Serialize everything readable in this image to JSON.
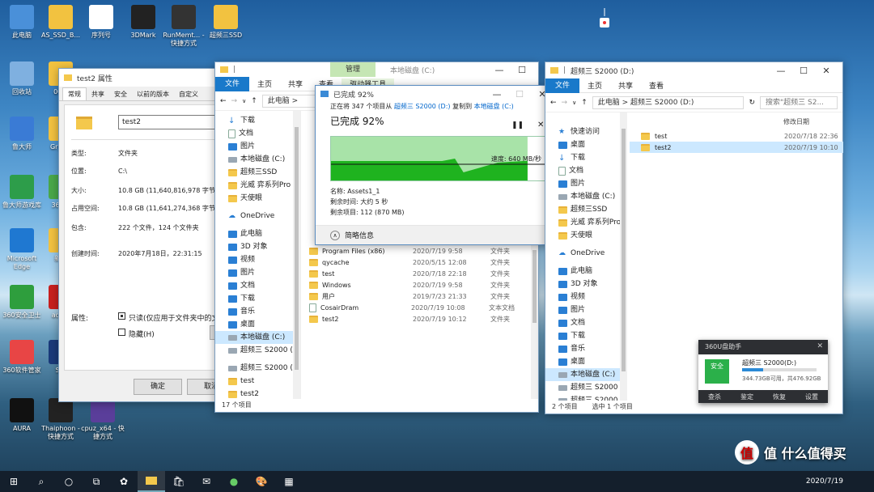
{
  "desktop": {
    "icons": [
      {
        "label": "此电脑",
        "color": "#4a90d9"
      },
      {
        "label": "AS_SSD_B...",
        "color": "#f2c240"
      },
      {
        "label": "序列号",
        "color": "#ffffff"
      },
      {
        "label": "3DMark",
        "color": "#222222"
      },
      {
        "label": "RunMemt... - 快捷方式",
        "color": "#333333"
      },
      {
        "label": "超频三SSD",
        "color": "#f2c240"
      },
      {
        "label": "回收站",
        "color": "#7fb0e0"
      },
      {
        "label": "00...",
        "color": "#f2c240"
      },
      {
        "label": "鲁大师",
        "color": "#3a7bd5"
      },
      {
        "label": "Grys...",
        "color": "#f2c240"
      },
      {
        "label": "鲁大师游戏库",
        "color": "#2d9d4a"
      },
      {
        "label": "360...",
        "color": "#4aa84a"
      },
      {
        "label": "Microsoft Edge",
        "color": "#1f78d1"
      },
      {
        "label": "新...",
        "color": "#f2c240"
      },
      {
        "label": "360安全卫士",
        "color": "#2e9e3d"
      },
      {
        "label": "ada...",
        "color": "#c8201f"
      },
      {
        "label": "360软件管家",
        "color": "#e84545"
      },
      {
        "label": "S...",
        "color": "#1a3a7a"
      },
      {
        "label": "AURA",
        "color": "#111111"
      },
      {
        "label": "Thaiphoon - 快捷方式",
        "color": "#222222"
      },
      {
        "label": "cpuz_x64 - 快捷方式",
        "color": "#5a3e9a"
      }
    ]
  },
  "props": {
    "title": "test2 属性",
    "tabs": [
      "常规",
      "共享",
      "安全",
      "以前的版本",
      "自定义"
    ],
    "name_value": "test2",
    "rows": [
      {
        "label": "类型:",
        "value": "文件夹"
      },
      {
        "label": "位置:",
        "value": "C:\\"
      },
      {
        "label": "大小:",
        "value": "10.8 GB (11,640,816,978 字节)"
      },
      {
        "label": "占用空间:",
        "value": "10.8 GB (11,641,274,368 字节)"
      },
      {
        "label": "包含:",
        "value": "222 个文件，124 个文件夹"
      },
      {
        "label": "创建时间:",
        "value": "2020年7月18日，22:31:15"
      }
    ],
    "attr_label": "属性:",
    "readonly_label": "只读(仅应用于文件夹中的文件)",
    "hidden_label": "隐藏(H)",
    "ok_label": "确定",
    "cancel_label": "取消"
  },
  "explorer_c": {
    "title": "本地磁盘 (C:)",
    "manage_tab": "管理",
    "drive_tools": "驱动器工具",
    "ribbon": [
      "文件",
      "主页",
      "共享",
      "查看"
    ],
    "breadcrumb": "此电脑 >",
    "nav": [
      {
        "label": "下载",
        "icon": "download"
      },
      {
        "label": "文档",
        "icon": "doc"
      },
      {
        "label": "图片",
        "icon": "pic"
      },
      {
        "label": "本地磁盘 (C:)",
        "icon": "drive"
      },
      {
        "label": "超频三SSD",
        "icon": "folder"
      },
      {
        "label": "光威 弈系列Pro",
        "icon": "folder"
      },
      {
        "label": "天使眼",
        "icon": "folder"
      },
      {
        "label": "OneDrive",
        "icon": "cloud"
      },
      {
        "label": "此电脑",
        "icon": "pc"
      },
      {
        "label": "3D 对象",
        "icon": "blue"
      },
      {
        "label": "视频",
        "icon": "blue"
      },
      {
        "label": "图片",
        "icon": "blue"
      },
      {
        "label": "文档",
        "icon": "blue"
      },
      {
        "label": "下载",
        "icon": "blue"
      },
      {
        "label": "音乐",
        "icon": "blue"
      },
      {
        "label": "桌面",
        "icon": "blue"
      },
      {
        "label": "本地磁盘 (C:)",
        "icon": "drive"
      },
      {
        "label": "超频三 S2000 (D:)",
        "icon": "drive"
      },
      {
        "label": "超频三 S2000 (D:)",
        "icon": "drive"
      },
      {
        "label": "test",
        "icon": "folder"
      },
      {
        "label": "test2",
        "icon": "folder"
      }
    ],
    "files": [
      {
        "name": "Program Files (x86)",
        "date": "2020/7/19 9:58",
        "type": "文件夹",
        "icon": "folder"
      },
      {
        "name": "qycache",
        "date": "2020/5/15 12:08",
        "type": "文件夹",
        "icon": "folder"
      },
      {
        "name": "test",
        "date": "2020/7/18 22:18",
        "type": "文件夹",
        "icon": "folder"
      },
      {
        "name": "Windows",
        "date": "2020/7/19 9:58",
        "type": "文件夹",
        "icon": "folder"
      },
      {
        "name": "用户",
        "date": "2019/7/23 21:33",
        "type": "文件夹",
        "icon": "folder"
      },
      {
        "name": "CosairDram",
        "date": "2020/7/19 10:08",
        "type": "文本文档",
        "icon": "doc"
      },
      {
        "name": "test2",
        "date": "2020/7/19 10:12",
        "type": "文件夹",
        "icon": "folder"
      }
    ],
    "status": "17 个项目"
  },
  "copy": {
    "title": "已完成 92%",
    "line1_prefix": "正在将 347 个项目从",
    "source": "超频三 S2000 (D:)",
    "line1_mid": "复制到",
    "dest": "本地磁盘 (C:)",
    "heading": "已完成 92%",
    "progress": 0.92,
    "speed": "速度: 640 MB/秒",
    "name": "名称: Assets1_1",
    "remaining_time": "剩余时间: 大约 5 秒",
    "remaining_items": "剩余项目: 112 (870 MB)",
    "less_info": "简略信息",
    "colors": {
      "fill": "#1fb31f",
      "bg": "#a8e3a8"
    }
  },
  "explorer_d": {
    "title": "超频三 S2000 (D:)",
    "ribbon": [
      "文件",
      "主页",
      "共享",
      "查看"
    ],
    "breadcrumb": "此电脑 > 超频三 S2000 (D:)",
    "search_placeholder": "搜索\"超频三 S2...",
    "col_date": "修改日期",
    "nav": [
      {
        "label": "快速访问",
        "icon": "star"
      },
      {
        "label": "桌面",
        "icon": "blue"
      },
      {
        "label": "下载",
        "icon": "download"
      },
      {
        "label": "文档",
        "icon": "doc"
      },
      {
        "label": "图片",
        "icon": "pic"
      },
      {
        "label": "本地磁盘 (C:)",
        "icon": "drive"
      },
      {
        "label": "超频三SSD",
        "icon": "folder"
      },
      {
        "label": "光威 弈系列Pro",
        "icon": "folder"
      },
      {
        "label": "天使眼",
        "icon": "folder"
      },
      {
        "label": "OneDrive",
        "icon": "cloud"
      },
      {
        "label": "此电脑",
        "icon": "pc"
      },
      {
        "label": "3D 对象",
        "icon": "blue"
      },
      {
        "label": "视频",
        "icon": "blue"
      },
      {
        "label": "图片",
        "icon": "blue"
      },
      {
        "label": "文档",
        "icon": "blue"
      },
      {
        "label": "下载",
        "icon": "blue"
      },
      {
        "label": "音乐",
        "icon": "blue"
      },
      {
        "label": "桌面",
        "icon": "blue"
      },
      {
        "label": "本地磁盘 (C:)",
        "icon": "drive"
      },
      {
        "label": "超频三 S2000 (D:)",
        "icon": "drive"
      },
      {
        "label": "超频三 S2000 (D:)",
        "icon": "drive"
      }
    ],
    "files": [
      {
        "name": "test",
        "date": "2020/7/18 22:36"
      },
      {
        "name": "test2",
        "date": "2020/7/19 10:10"
      }
    ],
    "status1": "2 个项目",
    "status2": "选中 1 个项目"
  },
  "u_helper": {
    "title": "360U盘助手",
    "badge": "安全",
    "drive_name": "超频三 S2000(D:)",
    "drive_space": "344.73GB可用，共476.92GB",
    "used_fraction": 0.28,
    "actions": [
      "查杀",
      "鉴定",
      "恢复",
      "设置"
    ]
  },
  "taskbar": {
    "date": "2020/7/19",
    "watermark": "值 什么值得买"
  }
}
